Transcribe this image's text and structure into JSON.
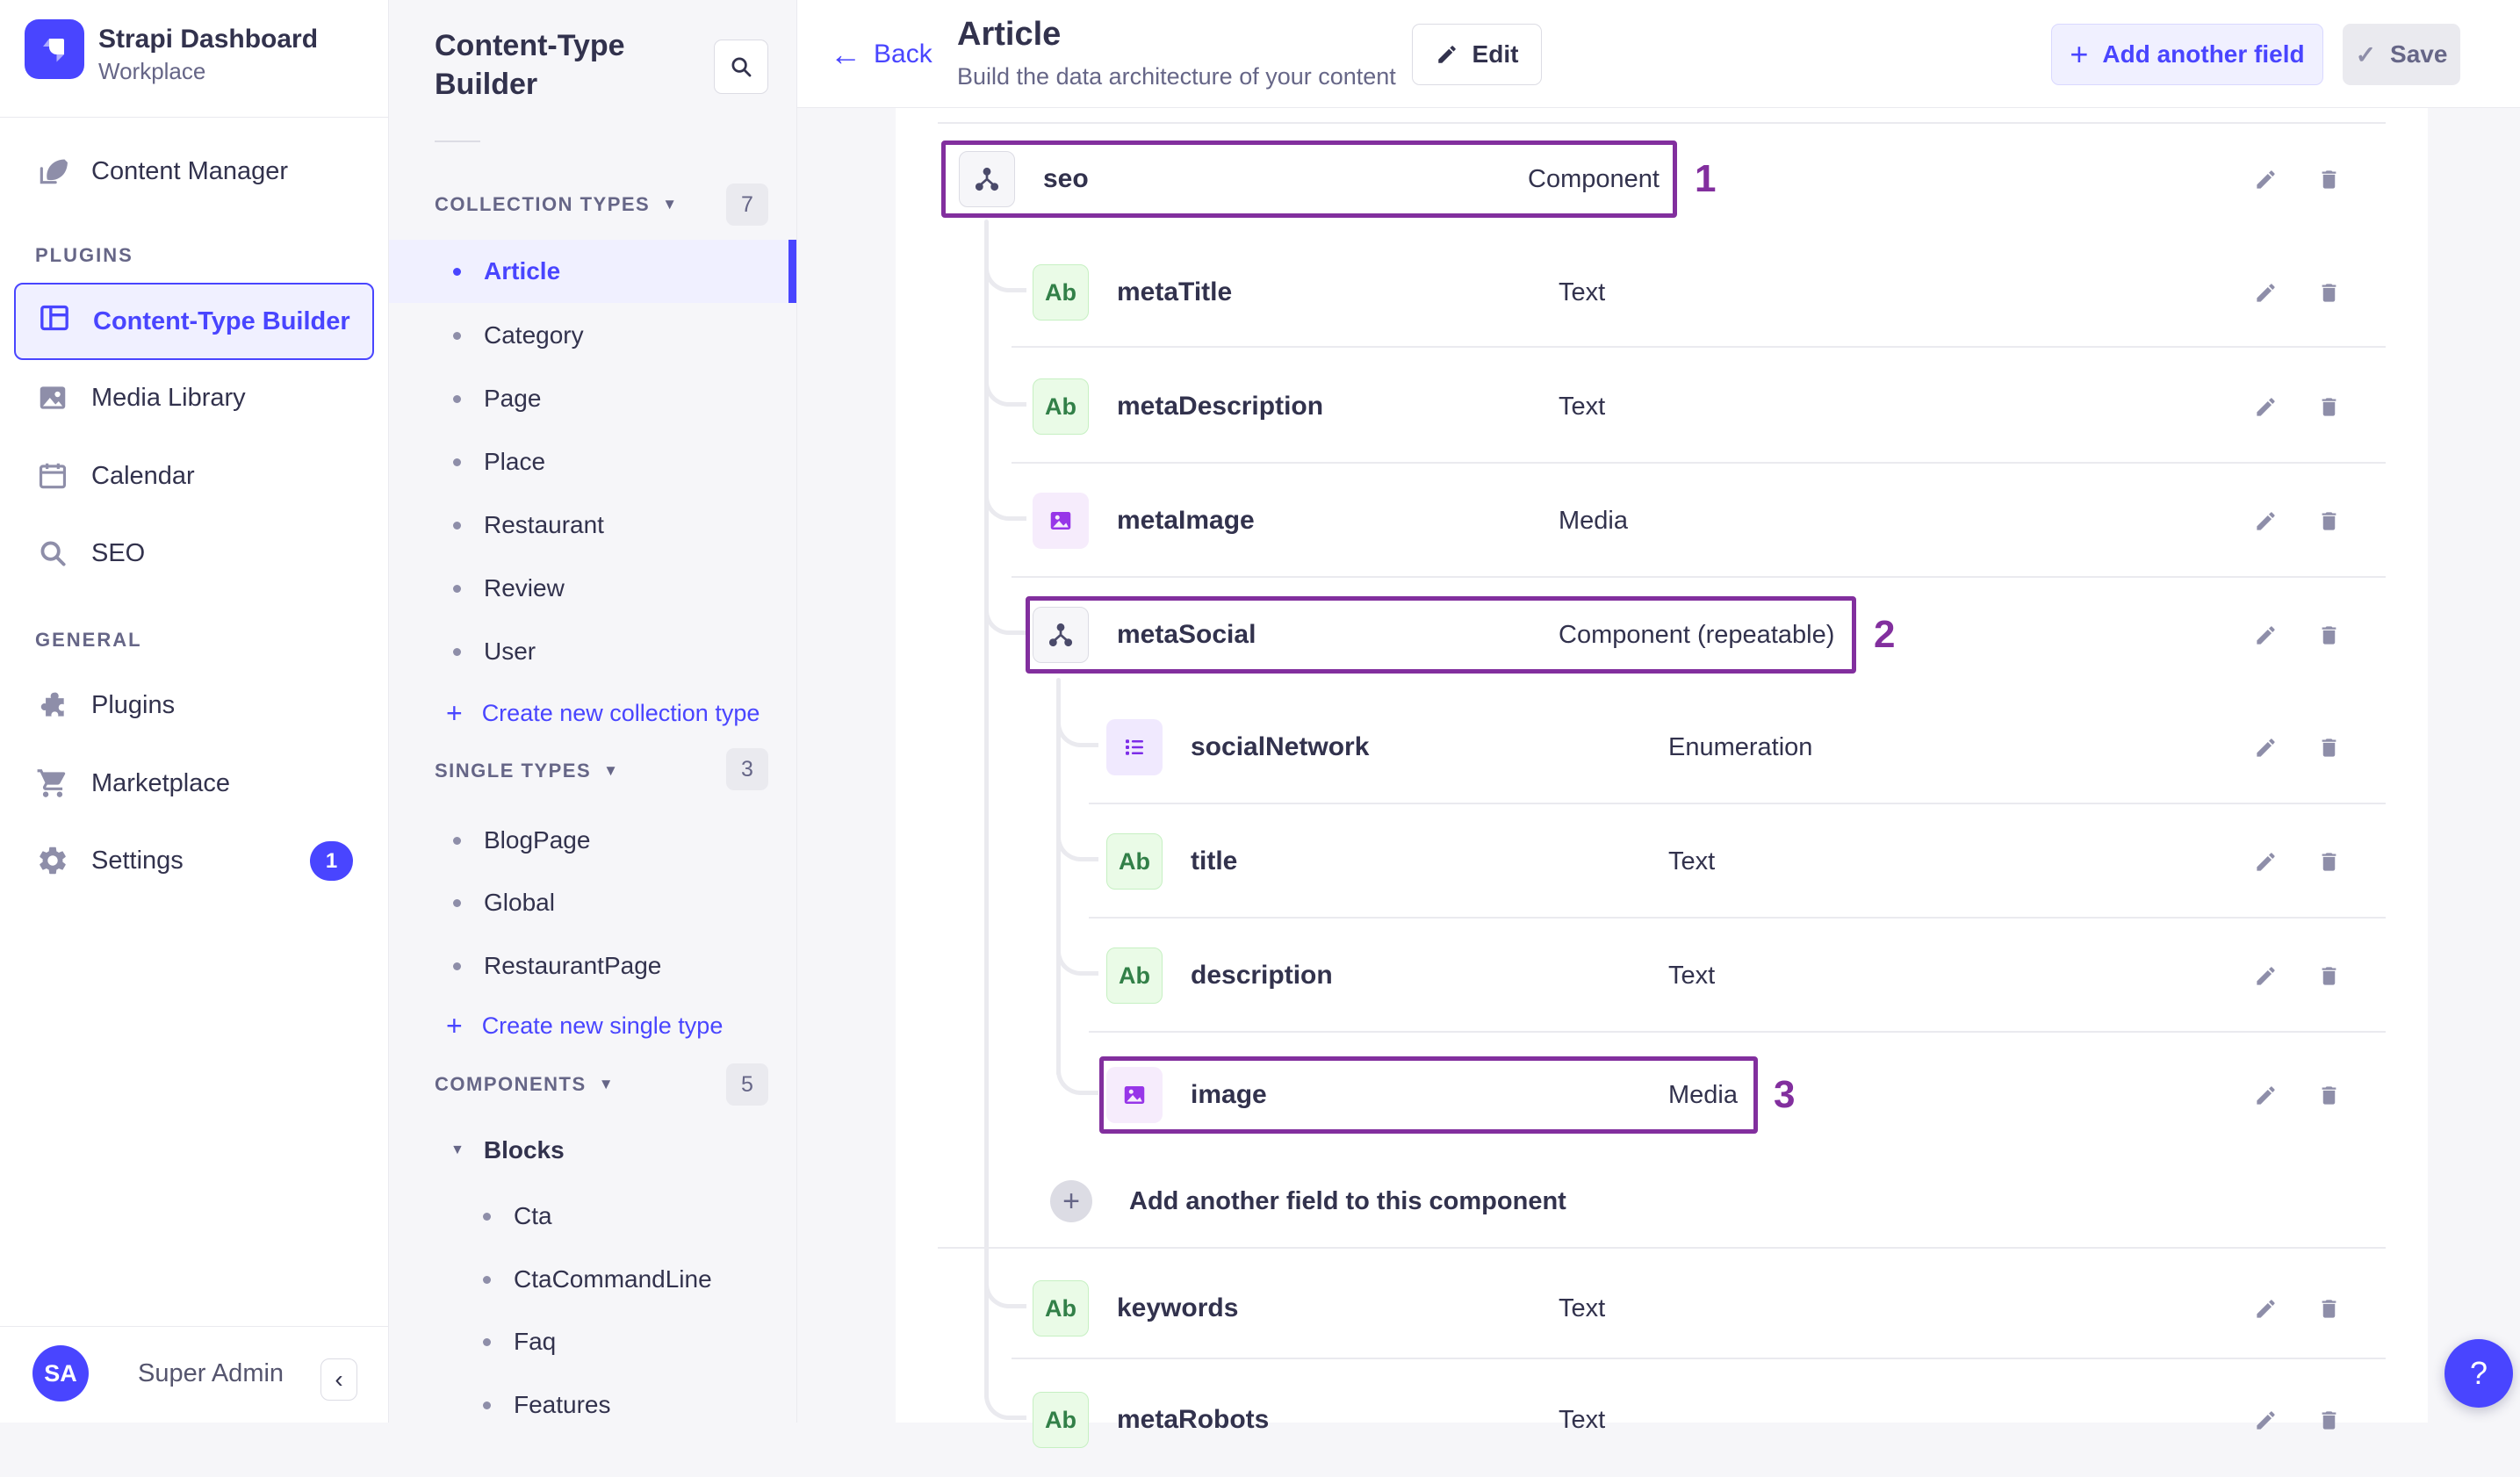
{
  "colors": {
    "primary": "#4945FF",
    "primary_bg": "#F0F0FF",
    "annotation": "#822F9E",
    "text_dark": "#32324D",
    "text_gray": "#666687",
    "icon_gray": "#8E8EA9",
    "text_field_green": "#328048",
    "media_purple": "#9736E8"
  },
  "app": {
    "name": "Strapi Dashboard",
    "workspace": "Workplace",
    "user_initials": "SA",
    "user_name": "Super Admin",
    "collapse": "‹",
    "help": "?"
  },
  "sidebar": {
    "content_manager": "Content Manager",
    "plugins_label": "PLUGINS",
    "plugins_items": [
      {
        "label": "Content-Type Builder"
      },
      {
        "label": "Media Library"
      },
      {
        "label": "Calendar"
      },
      {
        "label": "SEO"
      }
    ],
    "general_label": "GENERAL",
    "general_items": [
      {
        "label": "Plugins"
      },
      {
        "label": "Marketplace"
      },
      {
        "label": "Settings",
        "badge": "1"
      }
    ]
  },
  "nav": {
    "title": "Content-Type Builder",
    "collection": {
      "label": "COLLECTION TYPES",
      "badge": "7",
      "items": [
        "Article",
        "Category",
        "Page",
        "Place",
        "Restaurant",
        "Review",
        "User"
      ],
      "action": "Create new collection type"
    },
    "single": {
      "label": "SINGLE TYPES",
      "badge": "3",
      "items": [
        "BlogPage",
        "Global",
        "RestaurantPage"
      ],
      "action": "Create new single type"
    },
    "components": {
      "label": "COMPONENTS",
      "badge": "5",
      "group": "Blocks",
      "items": [
        "Cta",
        "CtaCommandLine",
        "Faq",
        "Features"
      ]
    }
  },
  "header": {
    "back": "Back",
    "title": "Article",
    "subtitle": "Build the data architecture of your content",
    "edit": "Edit",
    "add_field": "Add another field",
    "save": "Save"
  },
  "main": {
    "rows": [
      {
        "name": "seo",
        "type": "Component"
      },
      {
        "name": "metaTitle",
        "type": "Text"
      },
      {
        "name": "metaDescription",
        "type": "Text"
      },
      {
        "name": "metaImage",
        "type": "Media"
      },
      {
        "name": "metaSocial",
        "type": "Component (repeatable)"
      },
      {
        "name": "socialNetwork",
        "type": "Enumeration"
      },
      {
        "name": "title",
        "type": "Text"
      },
      {
        "name": "description",
        "type": "Text"
      },
      {
        "name": "image",
        "type": "Media"
      },
      {
        "name": "keywords",
        "type": "Text"
      },
      {
        "name": "metaRobots",
        "type": "Text"
      }
    ],
    "ab_glyph": "Ab",
    "add_row_label": "Add another field to this component",
    "annotations": {
      "a1": "1",
      "a2": "2",
      "a3": "3"
    }
  }
}
